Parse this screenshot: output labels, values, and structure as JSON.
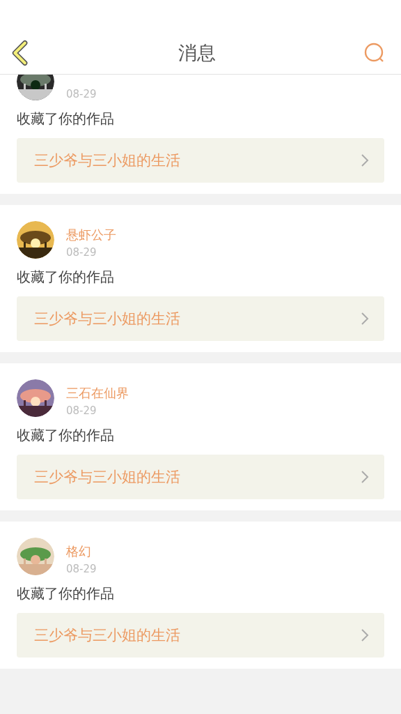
{
  "header": {
    "title": "消息"
  },
  "messages": [
    {
      "date": "08-29",
      "action": "收藏了你的作品",
      "work": "三少爷与三小姐的生活"
    },
    {
      "name": "悬虾公子",
      "date": "08-29",
      "action": "收藏了你的作品",
      "work": "三少爷与三小姐的生活"
    },
    {
      "name": "三石在仙界",
      "date": "08-29",
      "action": "收藏了你的作品",
      "work": "三少爷与三小姐的生活"
    },
    {
      "name": "格幻",
      "date": "08-29",
      "action": "收藏了你的作品",
      "work": "三少爷与三小姐的生活"
    }
  ]
}
